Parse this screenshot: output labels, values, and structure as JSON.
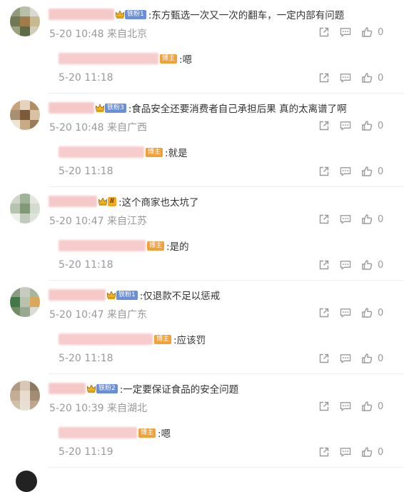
{
  "comments": [
    {
      "text": ":东方甄选一次又一次的翻车，一定内部有问题",
      "badge": "铁粉1",
      "badge_style": "blue",
      "meta": "5-20 10:48 来自北京",
      "likes": "0",
      "avatar_colors": [
        "#8f9b7a",
        "#b7bfa6",
        "#d9d9cf",
        "#6f7a55",
        "#a37b4a",
        "#c9b98e",
        "#9aa37c",
        "#5e6b47",
        "#d2cdb8"
      ],
      "reply": {
        "text": ":嗯",
        "badge": "博主",
        "meta": "5-20 11:18",
        "likes": "0"
      }
    },
    {
      "text": ":食品安全还要消费者自己承担后果 真的太离谱了啊",
      "badge": "铁粉3",
      "badge_style": "blue",
      "meta": "5-20 10:48 来自广西",
      "likes": "0",
      "avatar_colors": [
        "#c9a27a",
        "#e6d3bd",
        "#b08d62",
        "#a88f70",
        "#7d5a3a",
        "#d9c2a3",
        "#efe3d3",
        "#c6ab86",
        "#9c7b58"
      ],
      "reply": {
        "text": ":就是",
        "badge": "博主",
        "meta": "5-20 11:18",
        "likes": "0"
      }
    },
    {
      "text": ":这个商家也太坑了",
      "badge": "Ⅱ",
      "badge_style": "gold",
      "meta": "5-20 10:47 来自江苏",
      "likes": "0",
      "avatar_colors": [
        "#cfd6cc",
        "#9fb398",
        "#e3e7df",
        "#b4c4ae",
        "#7f9a75",
        "#d4dcd0",
        "#eef0eb",
        "#c0cbbb",
        "#dfe4db"
      ],
      "reply": {
        "text": ":是的",
        "badge": "博主",
        "meta": "5-20 11:18",
        "likes": "0"
      }
    },
    {
      "text": ":仅退款不足以惩戒",
      "badge": "铁粉1",
      "badge_style": "blue",
      "meta": "5-20 10:47 来自广东",
      "likes": "0",
      "avatar_colors": [
        "#8e9a84",
        "#c7cbc2",
        "#a9b59d",
        "#3f7a46",
        "#b9c2ad",
        "#d9a85a",
        "#6f8f62",
        "#9aa890",
        "#dadcd4"
      ],
      "reply": {
        "text": ":应该罚",
        "badge": "博主",
        "meta": "5-20 11:18",
        "likes": "0"
      }
    },
    {
      "text": ":一定要保证食品的安全问题",
      "badge": "铁粉2",
      "badge_style": "blue",
      "meta": "5-20 10:39 来自湖北",
      "likes": "0",
      "avatar_colors": [
        "#b09a82",
        "#d9c8b4",
        "#8d7860",
        "#c4ad93",
        "#e7dccd",
        "#a48c72",
        "#d0bfa9",
        "#e9e0d4",
        "#bda68c"
      ],
      "reply": {
        "text": ":嗯",
        "badge": "博主",
        "meta": "5-20 11:19",
        "likes": "0"
      }
    }
  ],
  "icons": {
    "share": "share-icon",
    "reply": "comment-icon",
    "like": "thumbs-up-icon"
  },
  "colors": {
    "username_blur": "#f6c9c9",
    "fan_badge": "#6a8fd6",
    "blogger_badge": "#f0a13a",
    "meta": "#999999"
  }
}
